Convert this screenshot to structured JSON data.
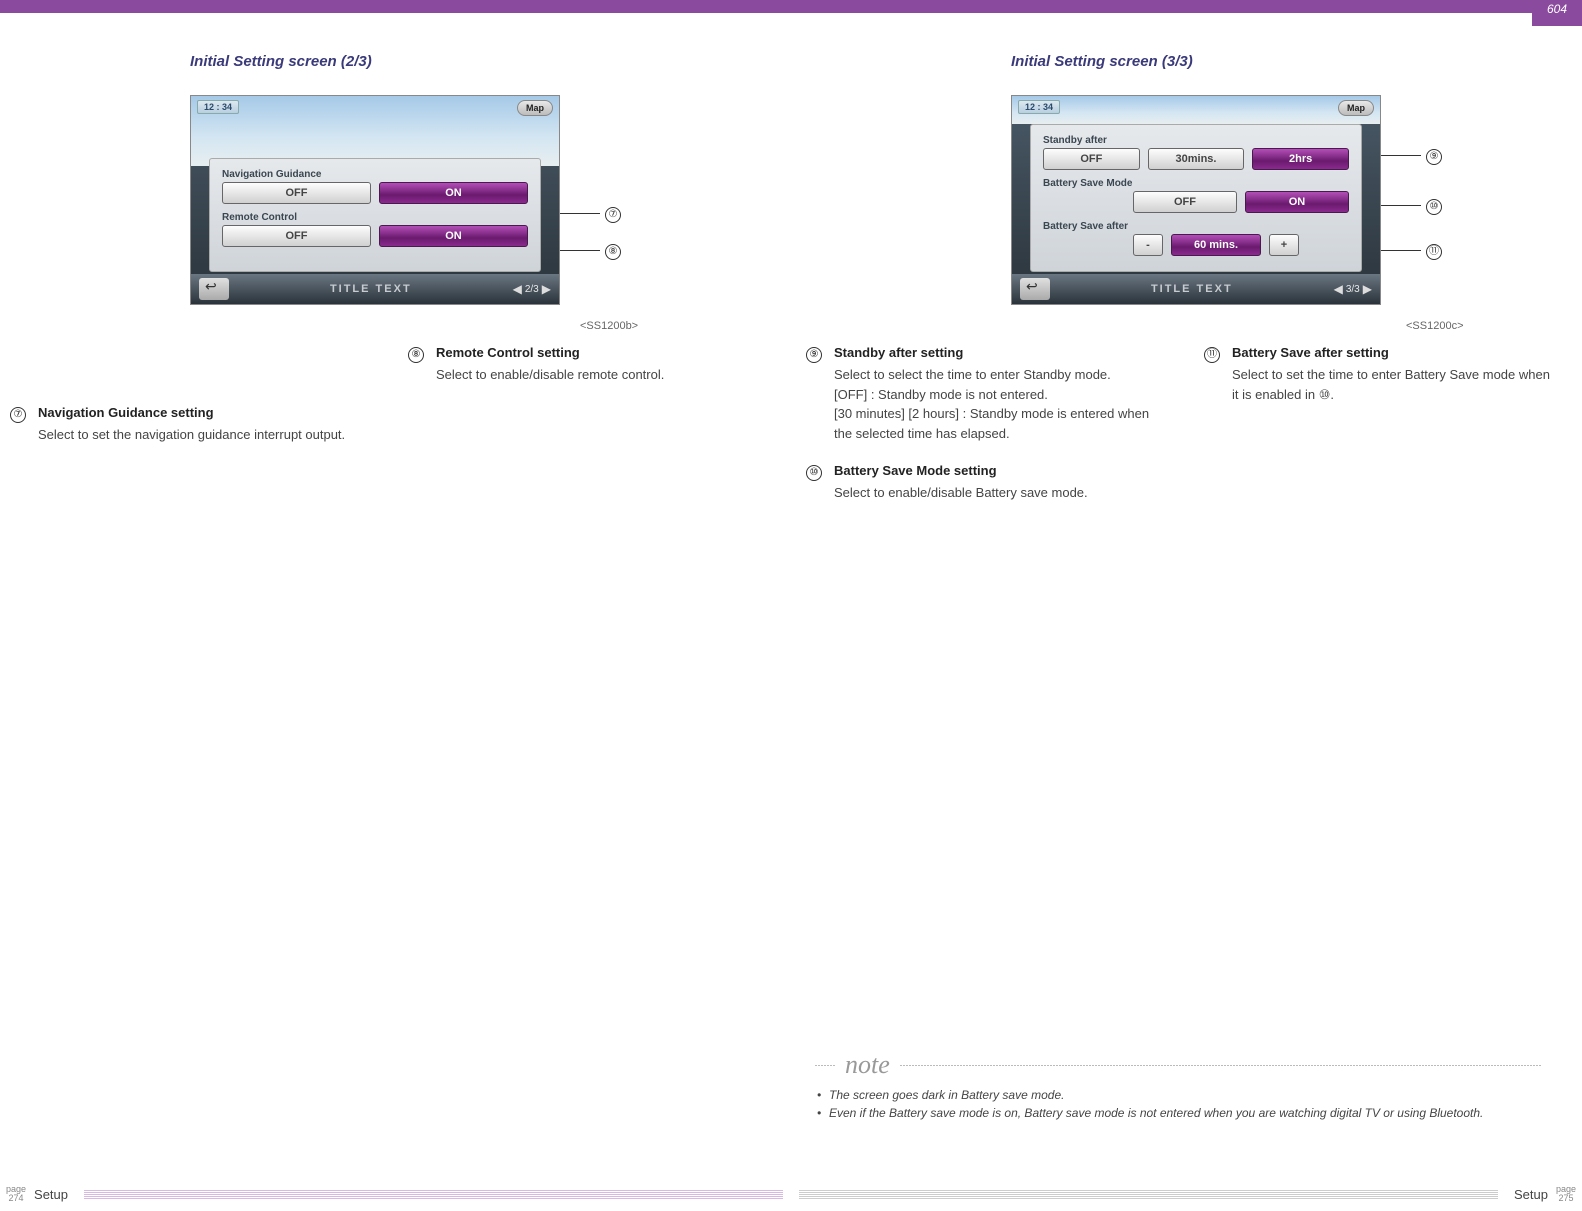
{
  "header": {
    "doc_number": "604"
  },
  "left": {
    "title": "Initial Setting screen (2/3)",
    "ss_label": "<SS1200b>",
    "screen": {
      "clock": "12 : 34",
      "map": "Map",
      "rows": [
        {
          "label": "Navigation Guidance",
          "opts": [
            "OFF",
            "ON"
          ],
          "sel": 1
        },
        {
          "label": "Remote Control",
          "opts": [
            "OFF",
            "ON"
          ],
          "sel": 1
        }
      ],
      "footer_title": "TITLE TEXT",
      "page_ind": "2/3"
    },
    "callouts": [
      "⑦",
      "⑧"
    ]
  },
  "right": {
    "title": "Initial Setting screen (3/3)",
    "ss_label": "<SS1200c>",
    "screen": {
      "clock": "12 : 34",
      "map": "Map",
      "rows": [
        {
          "label": "Standby after",
          "opts": [
            "OFF",
            "30mins.",
            "2hrs"
          ],
          "sel": 2
        },
        {
          "label": "Battery Save Mode",
          "opts": [
            "OFF",
            "ON"
          ],
          "sel": 1
        },
        {
          "label": "Battery Save after",
          "opts": [
            "-",
            "60 mins.",
            "+"
          ],
          "sel": 1
        }
      ],
      "footer_title": "TITLE TEXT",
      "page_ind": "3/3"
    },
    "callouts": [
      "⑨",
      "⑩",
      "⑪"
    ]
  },
  "desc": {
    "c7": {
      "n": "⑦",
      "t": "Navigation Guidance setting",
      "d": "Select to set the navigation guidance interrupt output."
    },
    "c8": {
      "n": "⑧",
      "t": "Remote Control setting",
      "d": "Select to enable/disable remote control."
    },
    "c9": {
      "n": "⑨",
      "t": "Standby after setting",
      "d": "Select to select the time to enter Standby mode.\n[OFF] : Standby mode is not entered.\n[30 minutes] [2 hours] : Standby mode is entered when the selected time has elapsed."
    },
    "c10": {
      "n": "⑩",
      "t": "Battery Save Mode setting",
      "d": "Select to enable/disable Battery save mode."
    },
    "c11": {
      "n": "⑪",
      "t": "Battery Save after setting",
      "d": "Select to set the time to enter Battery Save mode when it is enabled in ⑩."
    }
  },
  "note": {
    "label": "note",
    "items": [
      "The screen goes dark in Battery save mode.",
      "Even if the Battery save mode is on, Battery save mode is not entered when you are watching digital TV or using Bluetooth."
    ]
  },
  "footer": {
    "left_page_lbl": "page",
    "left_page": "274",
    "left_cat": "Setup",
    "right_cat": "Setup",
    "right_page_lbl": "page",
    "right_page": "275"
  }
}
